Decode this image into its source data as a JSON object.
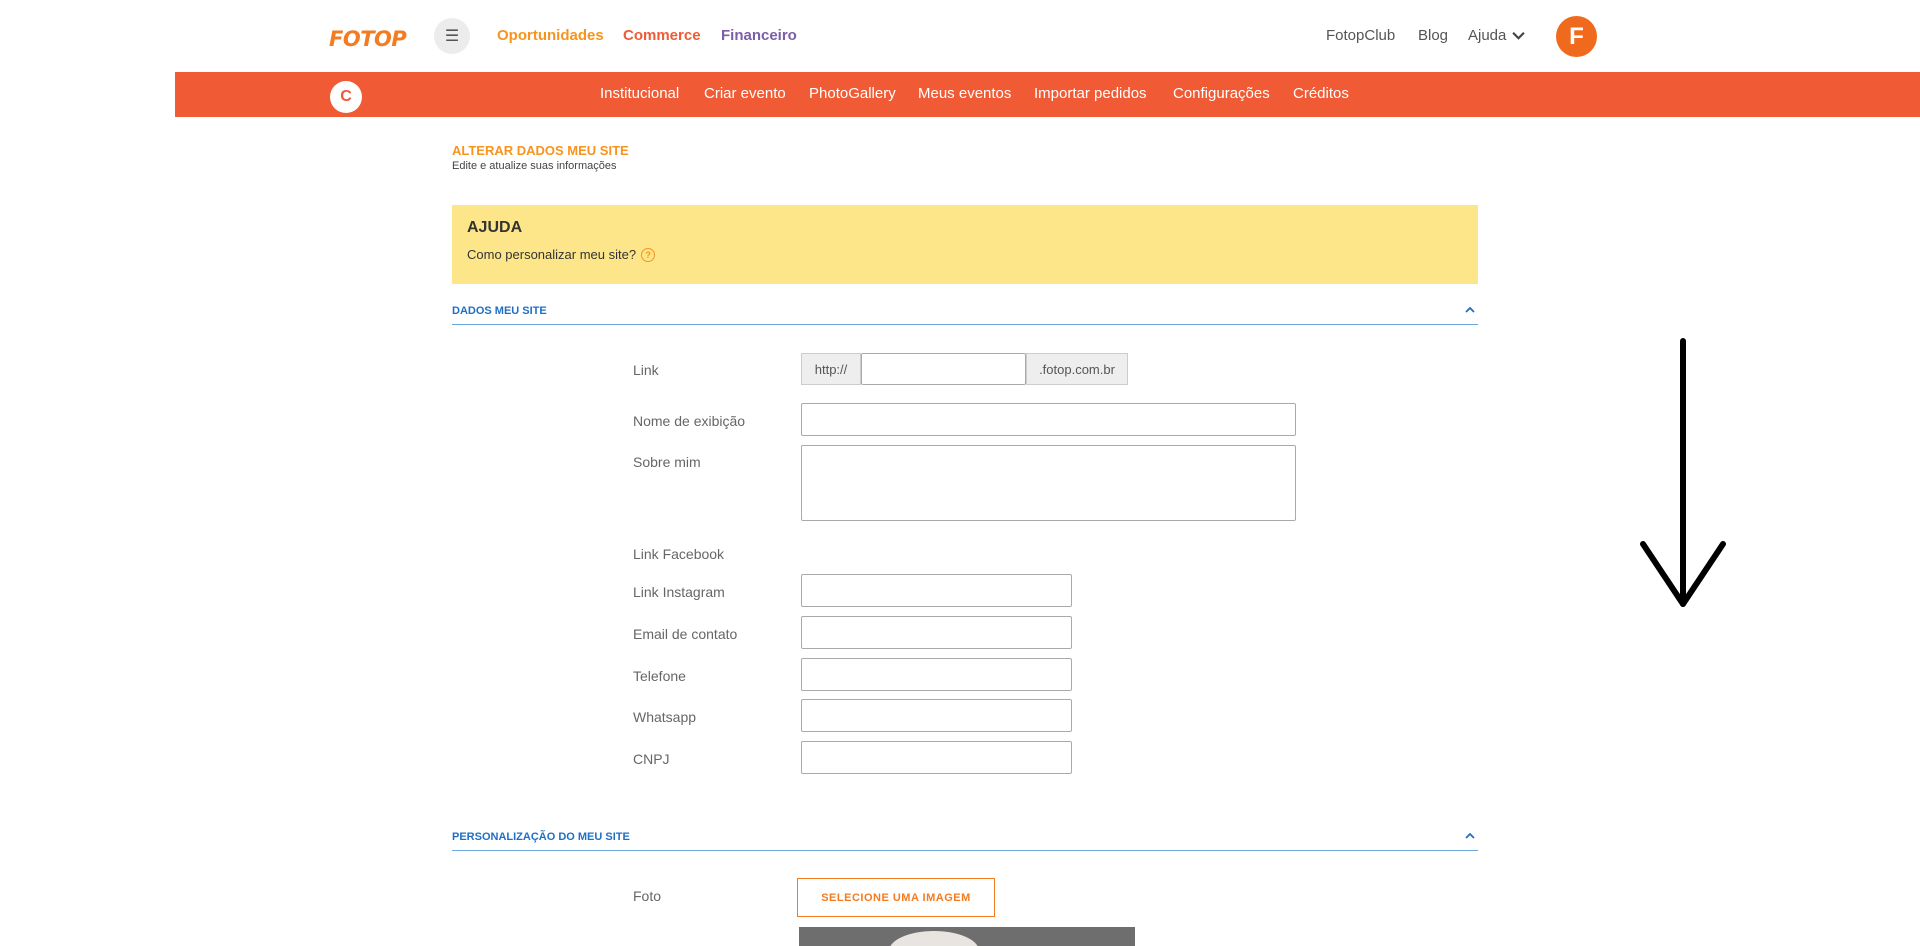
{
  "topbar": {
    "logo": "FOTOP",
    "menu_icon": "hamburger-icon",
    "links": {
      "oportunidades": "Oportunidades",
      "commerce": "Commerce",
      "financeiro": "Financeiro"
    },
    "right": {
      "club": "FotopClub",
      "blog": "Blog",
      "ajuda": "Ajuda"
    },
    "avatar_letter": "F"
  },
  "subbar": {
    "circle_letter": "C",
    "items": [
      "Institucional",
      "Criar evento",
      "PhotoGallery",
      "Meus eventos",
      "Importar pedidos",
      "Configurações",
      "Créditos"
    ]
  },
  "page": {
    "title": "ALTERAR DADOS MEU SITE",
    "subtitle": "Edite e atualize suas informações"
  },
  "help": {
    "title": "AJUDA",
    "text": "Como personalizar meu site?",
    "icon": "?"
  },
  "section1": {
    "label": "DADOS MEU SITE",
    "fields": {
      "link": "Link",
      "link_prefix": "http://",
      "link_suffix": ".fotop.com.br",
      "nome": "Nome de exibição",
      "sobre": "Sobre mim",
      "facebook": "Link Facebook",
      "instagram": "Link Instagram",
      "email": "Email de contato",
      "telefone": "Telefone",
      "whatsapp": "Whatsapp",
      "cnpj": "CNPJ"
    }
  },
  "section2": {
    "label": "PERSONALIZAÇÃO DO MEU SITE",
    "foto_label": "Foto",
    "select_button": "SELECIONE UMA IMAGEM"
  },
  "colors": {
    "orange": "#f05a35",
    "accent": "#f7941d",
    "purple": "#7b5ea7",
    "blue": "#1f6fc5",
    "help_bg": "#fde68a"
  }
}
